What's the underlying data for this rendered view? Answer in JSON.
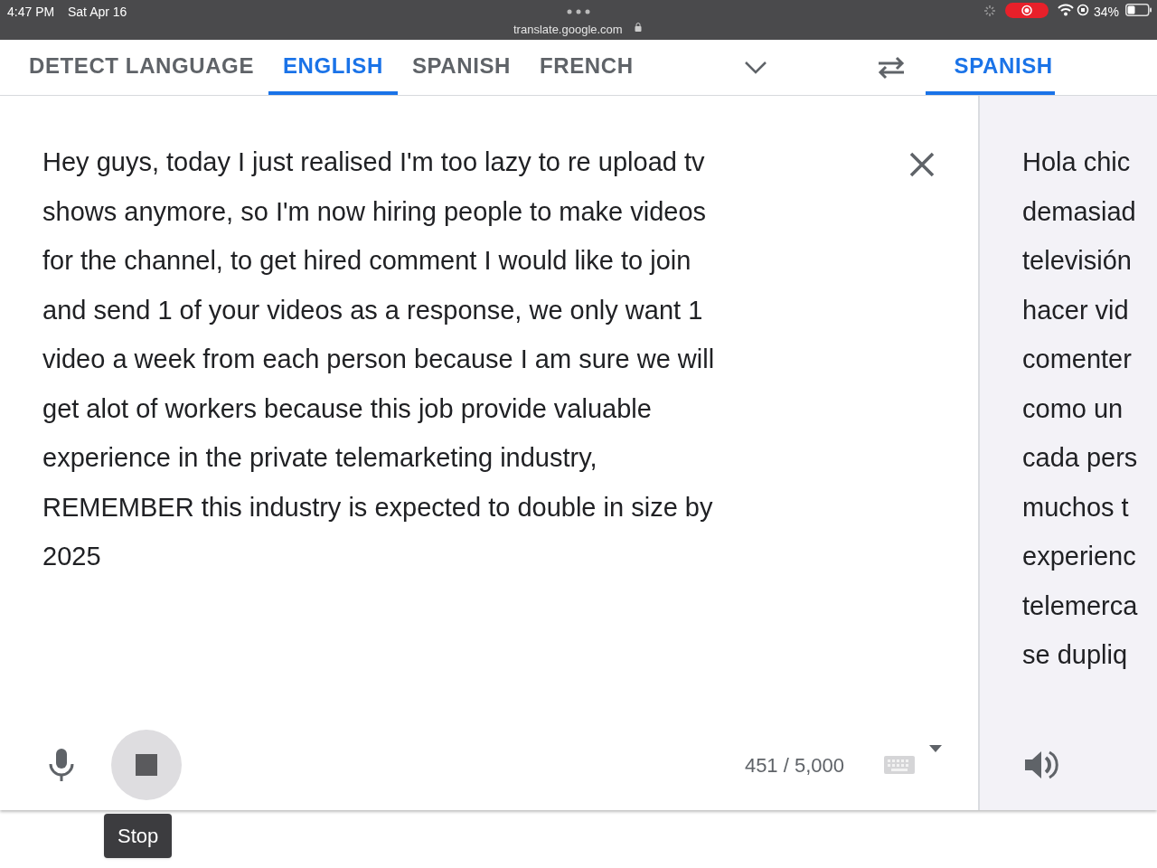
{
  "status_bar": {
    "time": "4:47 PM",
    "date": "Sat Apr 16",
    "url": "translate.google.com",
    "battery": "34%"
  },
  "source_tabs": [
    {
      "label": "DETECT LANGUAGE",
      "selected": false
    },
    {
      "label": "ENGLISH",
      "selected": true
    },
    {
      "label": "SPANISH",
      "selected": false
    },
    {
      "label": "FRENCH",
      "selected": false
    }
  ],
  "target_tabs": [
    {
      "label": "SPANISH",
      "selected": true
    }
  ],
  "source": {
    "lines": [
      "Hey guys, today I just realised I'm too lazy to re upload tv",
      "shows anymore, so I'm now hiring people to make videos",
      "for the channel, to get hired comment I would like to join",
      "and send 1 of your videos as a response, we only want 1",
      "video a week from each person because I am sure we will",
      "get alot of workers because this job provide valuable",
      "experience in the private telemarketing industry,",
      "REMEMBER this industry is expected to double in size by",
      "2025"
    ],
    "char_count": "451 / 5,000",
    "tooltip": "Stop"
  },
  "target": {
    "lines": [
      "Hola chic",
      "demasiad",
      "televisión",
      "hacer vid",
      "comenter",
      "como un",
      "cada pers",
      "muchos t",
      "experienc",
      "telemerca",
      "se dupliq"
    ]
  }
}
